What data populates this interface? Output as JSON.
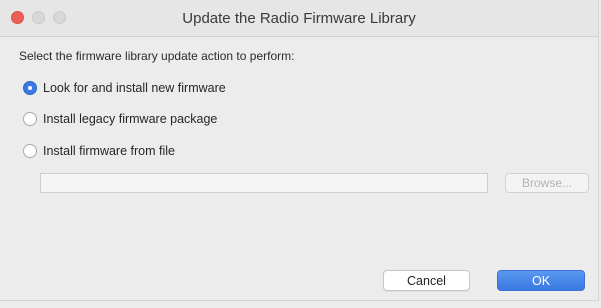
{
  "window": {
    "title": "Update the Radio Firmware Library"
  },
  "dialog": {
    "prompt": "Select the firmware library update action to perform:",
    "options": [
      {
        "label": "Look for and install new firmware",
        "selected": true
      },
      {
        "label": "Install legacy firmware package",
        "selected": false
      },
      {
        "label": "Install firmware from file",
        "selected": false
      }
    ],
    "file_path_value": "",
    "browse_label": "Browse...",
    "browse_enabled": false
  },
  "buttons": {
    "cancel_label": "Cancel",
    "ok_label": "OK"
  },
  "colors": {
    "accent": "#3b7ae0",
    "close_button": "#ec5f57",
    "window_background": "#ececec"
  }
}
